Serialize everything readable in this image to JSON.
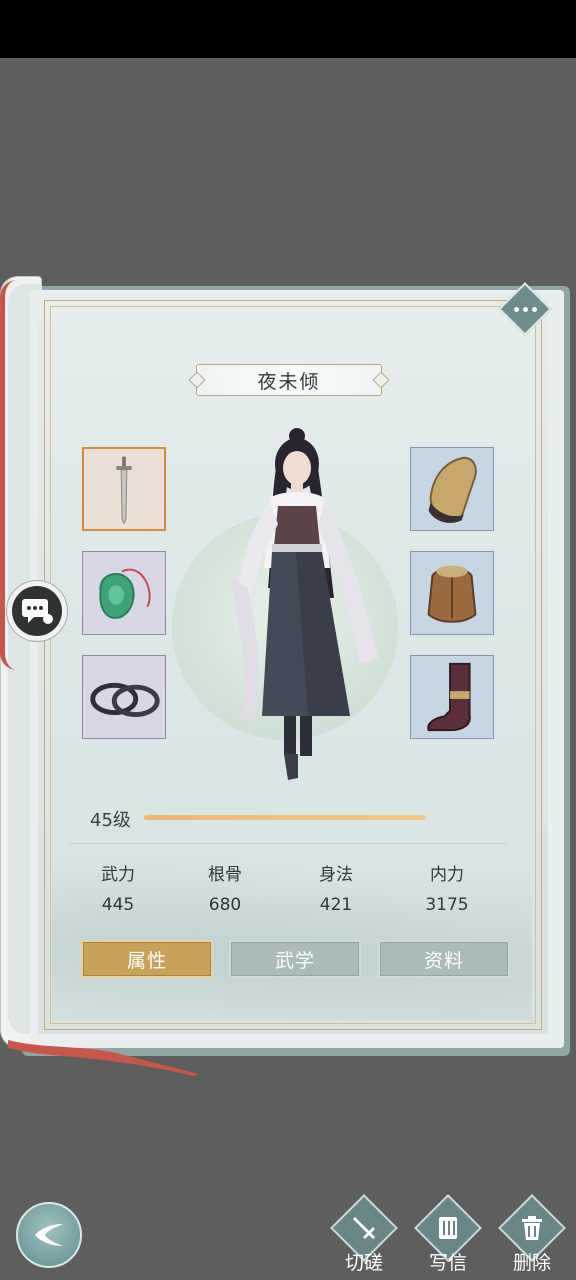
{
  "character": {
    "name": "夜未倾",
    "level_text": "45级",
    "level_progress": 1.0
  },
  "equipment": {
    "left": [
      {
        "icon": "sword-icon",
        "active": true
      },
      {
        "icon": "jade-pendant-icon",
        "active": false
      },
      {
        "icon": "bracelet-icon",
        "active": false
      }
    ],
    "right": [
      {
        "icon": "bracer-icon"
      },
      {
        "icon": "armor-icon"
      },
      {
        "icon": "boot-icon"
      }
    ]
  },
  "stats": [
    {
      "label": "武力",
      "value": "445"
    },
    {
      "label": "根骨",
      "value": "680"
    },
    {
      "label": "身法",
      "value": "421"
    },
    {
      "label": "内力",
      "value": "3175"
    }
  ],
  "tabs": [
    {
      "label": "属性",
      "active": true
    },
    {
      "label": "武学",
      "active": false
    },
    {
      "label": "资料",
      "active": false
    }
  ],
  "actions": [
    {
      "label": "切磋",
      "icon": "sword-icon"
    },
    {
      "label": "写信",
      "icon": "letter-icon"
    },
    {
      "label": "删除",
      "icon": "trash-icon"
    }
  ],
  "icons": {
    "more": "more-dots-icon",
    "chat": "chat-bubble-icon",
    "back": "back-arrow-icon"
  },
  "colors": {
    "accent_gold": "#c8a15a",
    "tab_inactive": "#a9bbbb",
    "level_bar": "#f0b870",
    "active_slot_border": "#d58a3c"
  }
}
